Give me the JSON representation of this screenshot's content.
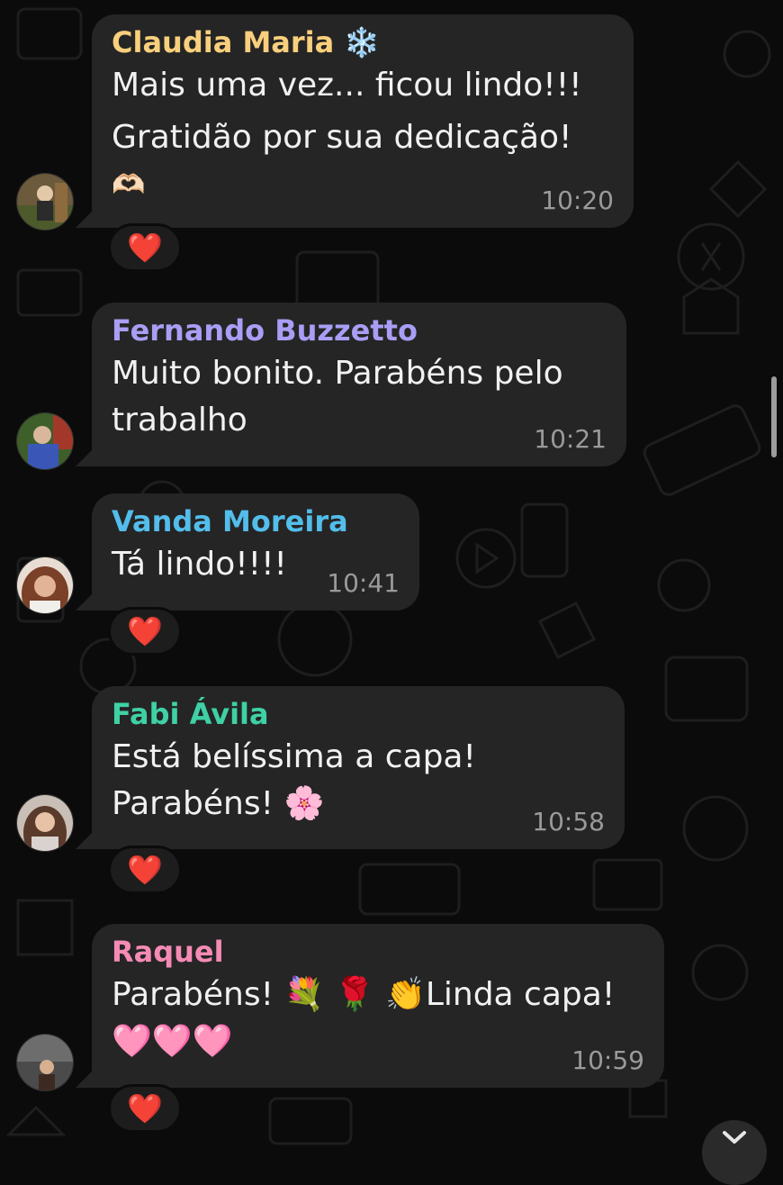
{
  "messages": [
    {
      "sender": "Claudia Maria",
      "sender_emoji": "❄️",
      "sender_color": "#f8cf7c",
      "lines": [
        "Mais uma vez... ficou lindo!!!",
        "Gratidão por sua dedicação!",
        "🫶🏻"
      ],
      "time": "10:20",
      "reaction": "❤️",
      "avatar": "avatar-claudia"
    },
    {
      "sender": "Fernando Buzzetto",
      "sender_color": "#a99ef5",
      "lines": [
        "Muito bonito. Parabéns pelo",
        "trabalho"
      ],
      "time": "10:21",
      "avatar": "avatar-fernando"
    },
    {
      "sender": "Vanda Moreira",
      "sender_color": "#53bdeb",
      "lines": [
        "Tá lindo!!!!"
      ],
      "time": "10:41",
      "reaction": "❤️",
      "avatar": "avatar-vanda"
    },
    {
      "sender": "Fabi Ávila",
      "sender_color": "#3fd1a5",
      "lines": [
        "Está belíssima a capa!",
        "Parabéns! 🌸"
      ],
      "time": "10:58",
      "reaction": "❤️",
      "avatar": "avatar-fabi"
    },
    {
      "sender": "Raquel",
      "sender_color": "#f58ab5",
      "lines": [
        "Parabéns! 💐 🌹 👏Linda capa!",
        "🩷🩷🩷"
      ],
      "time": "10:59",
      "reaction": "❤️",
      "avatar": "avatar-raquel"
    }
  ],
  "icons": {
    "scroll_down": "chevron-down-icon"
  }
}
